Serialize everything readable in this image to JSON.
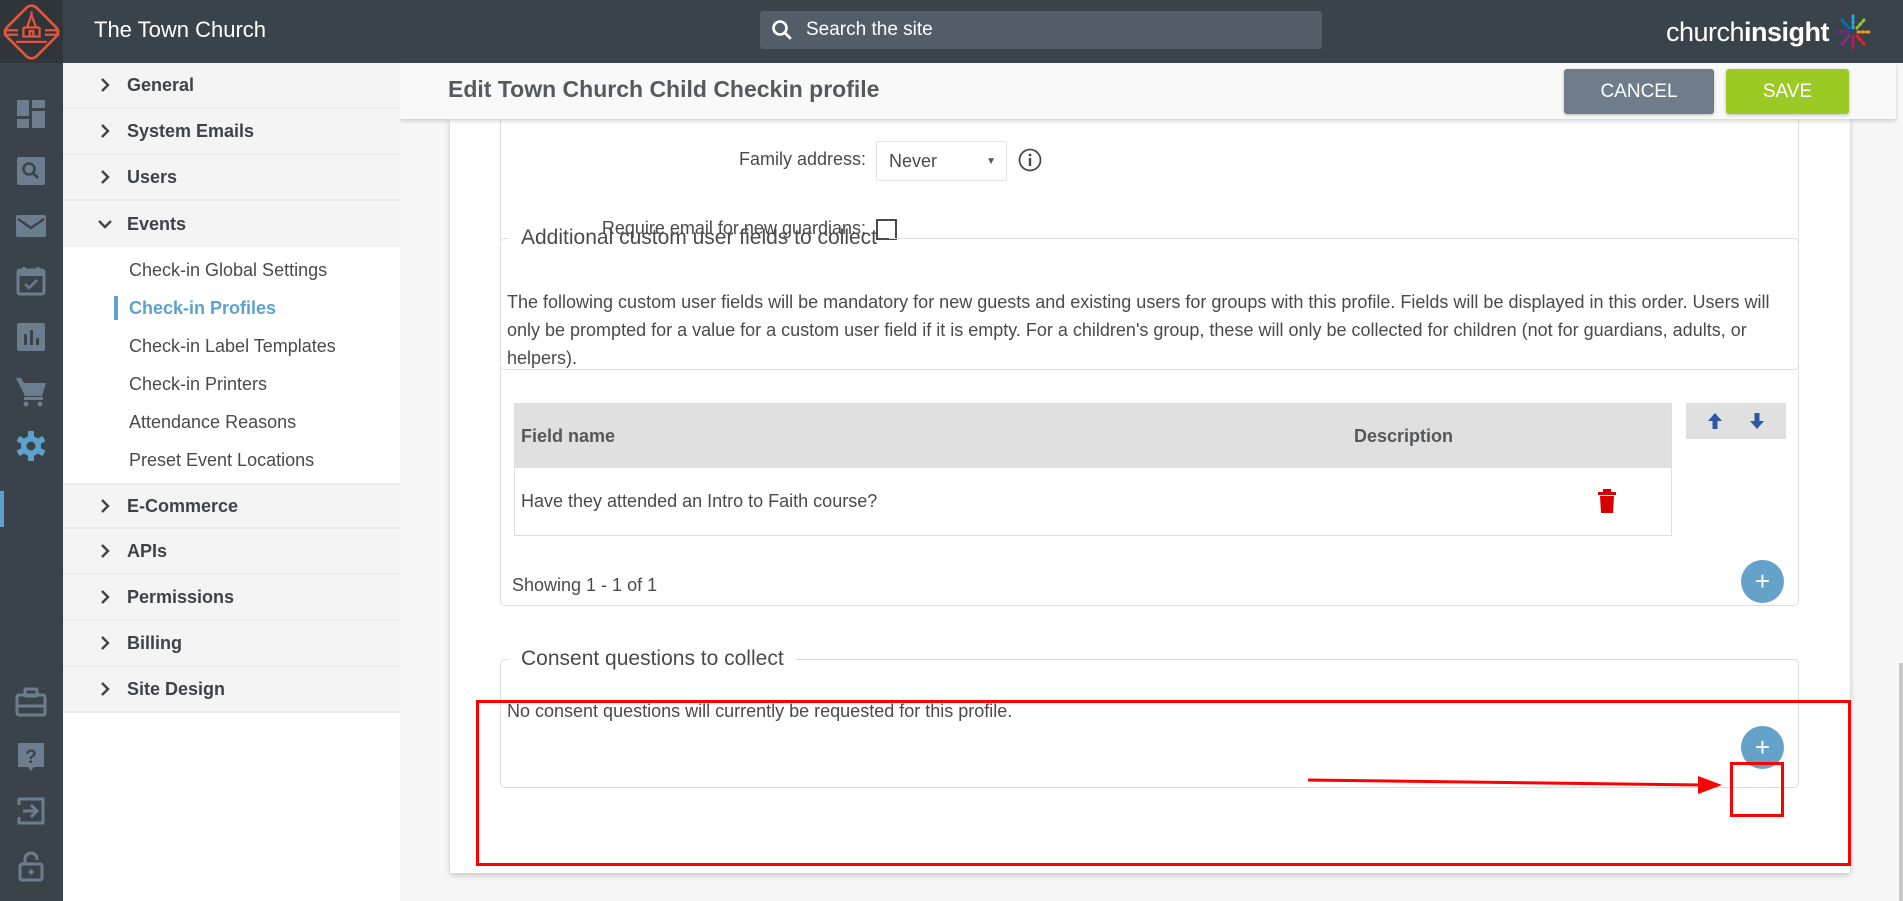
{
  "header": {
    "site_title": "The Town Church",
    "search_placeholder": "Search the site",
    "brand_light": "church",
    "brand_bold": "insight"
  },
  "rail": {
    "items": [
      {
        "name": "dashboard-icon"
      },
      {
        "name": "search-icon"
      },
      {
        "name": "mail-icon"
      },
      {
        "name": "calendar-check-icon"
      },
      {
        "name": "bar-chart-icon"
      },
      {
        "name": "cart-icon"
      },
      {
        "name": "gear-icon",
        "active": true
      },
      {
        "name": "briefcase-icon"
      },
      {
        "name": "help-icon"
      },
      {
        "name": "sign-in-icon"
      },
      {
        "name": "unlock-icon"
      }
    ]
  },
  "settings_nav": {
    "groups_before": [
      {
        "label": "General"
      },
      {
        "label": "System Emails"
      },
      {
        "label": "Users"
      }
    ],
    "expanded_group": {
      "label": "Events",
      "items": [
        {
          "label": "Check-in Global Settings"
        },
        {
          "label": "Check-in Profiles",
          "active": true
        },
        {
          "label": "Check-in Label Templates"
        },
        {
          "label": "Check-in Printers"
        },
        {
          "label": "Attendance Reasons"
        },
        {
          "label": "Preset Event Locations"
        }
      ]
    },
    "groups_after": [
      {
        "label": "E-Commerce"
      },
      {
        "label": "APIs"
      },
      {
        "label": "Permissions"
      },
      {
        "label": "Billing"
      },
      {
        "label": "Site Design"
      }
    ]
  },
  "page": {
    "title": "Edit Town Church Child Checkin profile",
    "cancel_label": "CANCEL",
    "save_label": "SAVE"
  },
  "guardian_settings": {
    "family_address_label": "Family address:",
    "family_address_value": "Never",
    "require_email_label": "Require email for new guardians:",
    "require_email_checked": false
  },
  "custom_fields": {
    "legend": "Additional custom user fields to collect",
    "description": "The following custom user fields will be mandatory for new guests and existing users for groups with this profile. Fields will be displayed in this order. Users will only be prompted for a value for a custom user field if it is empty. For a children's group, these will only be collected for children (not for guardians, adults, or helpers).",
    "columns": [
      "Field name",
      "Description"
    ],
    "rows": [
      {
        "field_name": "Have they attended an Intro to Faith course?",
        "description": ""
      }
    ],
    "showing": "Showing 1 - 1 of 1",
    "add_label": "+"
  },
  "consent": {
    "legend": "Consent questions to collect",
    "message": "No consent questions will currently be requested for this profile.",
    "add_label": "+"
  },
  "colors": {
    "header_bg": "#3b434a",
    "accent_blue": "#5da2cc",
    "save_green": "#9bca24",
    "cancel_grey": "#6e7c8c",
    "delete_red": "#d40000",
    "annotation_red": "#ff0000"
  }
}
